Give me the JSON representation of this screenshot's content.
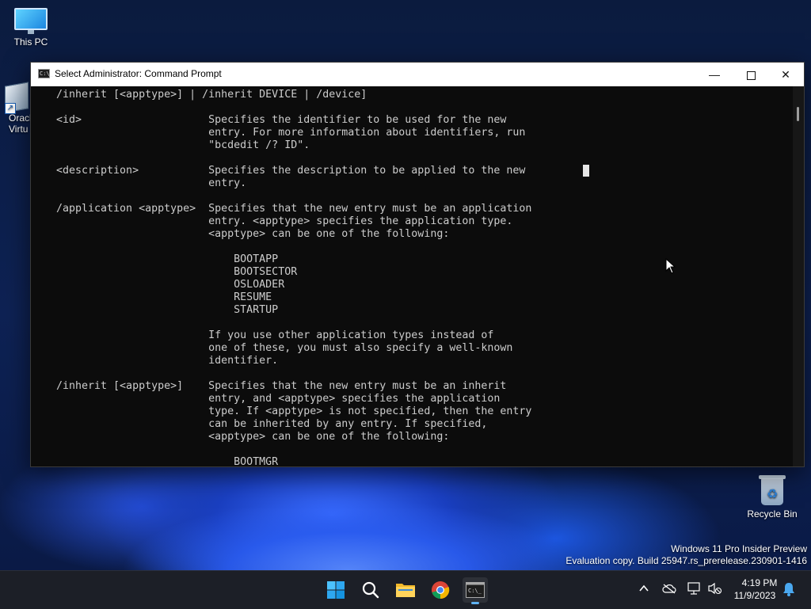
{
  "desktop": {
    "this_pc_label": "This PC",
    "vbox_label_line1": "Oracl",
    "vbox_label_line2": "Virtu",
    "recycle_bin_label": "Recycle Bin",
    "watermark_line1": "Windows 11 Pro Insider Preview",
    "watermark_line2": "Evaluation copy. Build 25947.rs_prerelease.230901-1416"
  },
  "window": {
    "title": "Select Administrator: Command Prompt",
    "icon_glyph": "C:\\_",
    "minimize_glyph": "—",
    "close_glyph": "✕"
  },
  "console": {
    "lines": [
      "/inherit [<apptype>] | /inherit DEVICE | /device]",
      "",
      "<id>                    Specifies the identifier to be used for the new",
      "                        entry. For more information about identifiers, run",
      "                        \"bcdedit /? ID\".",
      "",
      "<description>           Specifies the description to be applied to the new",
      "                        entry.",
      "",
      "/application <apptype>  Specifies that the new entry must be an application",
      "                        entry. <apptype> specifies the application type.",
      "                        <apptype> can be one of the following:",
      "",
      "                            BOOTAPP",
      "                            BOOTSECTOR",
      "                            OSLOADER",
      "                            RESUME",
      "                            STARTUP",
      "",
      "                        If you use other application types instead of",
      "                        one of these, you must also specify a well-known",
      "                        identifier.",
      "",
      "/inherit [<apptype>]    Specifies that the new entry must be an inherit",
      "                        entry, and <apptype> specifies the application",
      "                        type. If <apptype> is not specified, then the entry",
      "                        can be inherited by any entry. If specified,",
      "                        <apptype> can be one of the following:",
      "",
      "                            BOOTMGR"
    ]
  },
  "taskbar": {
    "start_icon": "windows-logo",
    "search_icon": "search",
    "explorer_icon": "folder",
    "chrome_icon": "chrome",
    "cmd_icon": "command-prompt",
    "time": "4:19 PM",
    "date": "11/9/2023"
  },
  "colors": {
    "console_bg": "#0c0c0c",
    "console_fg": "#cccccc",
    "taskbar_bg": "#1c1f27",
    "accent": "#5fb2f2"
  }
}
